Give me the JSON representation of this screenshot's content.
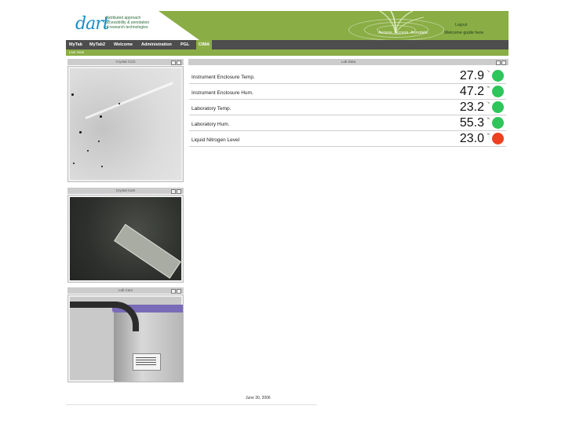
{
  "header": {
    "logo_word": "dart",
    "logo_tagline": [
      "distributed approach",
      "accessibility & annotation",
      "of research technologies"
    ],
    "logout": "Logout",
    "tagline": "Access. Access. Annotate.",
    "welcome": "Welcome guide here"
  },
  "nav": {
    "items": [
      "MyTab",
      "MyTab2",
      "Welcome",
      "Administration",
      "PGL",
      "CIMA"
    ],
    "active": "CIMA",
    "subbar": "Live View"
  },
  "panels": {
    "ccd_title": "Crystal CCD",
    "crystal_cam_title": "Crystal Cam",
    "lab_cam_title": "Lab Cam",
    "lab_data_title": "Lab Data"
  },
  "status_rows": [
    {
      "label": "Instrument Enclosure Temp.",
      "value": "27.9",
      "unit": "°c",
      "status": "ok"
    },
    {
      "label": "Instrument Enclosure Hum.",
      "value": "47.2",
      "unit": "%",
      "status": "ok"
    },
    {
      "label": "Laboratory Temp.",
      "value": "23.2",
      "unit": "°c",
      "status": "ok"
    },
    {
      "label": "Laboratory Hum.",
      "value": "55.3",
      "unit": "%",
      "status": "ok"
    },
    {
      "label": "Liquid Nitrogen Level",
      "value": "23.0",
      "unit": "%",
      "status": "alarm"
    }
  ],
  "colors": {
    "ok": "#2ec55a",
    "alarm": "#ee4020",
    "accent": "#8aad45"
  },
  "footer": {
    "date": "June 30, 2006"
  }
}
